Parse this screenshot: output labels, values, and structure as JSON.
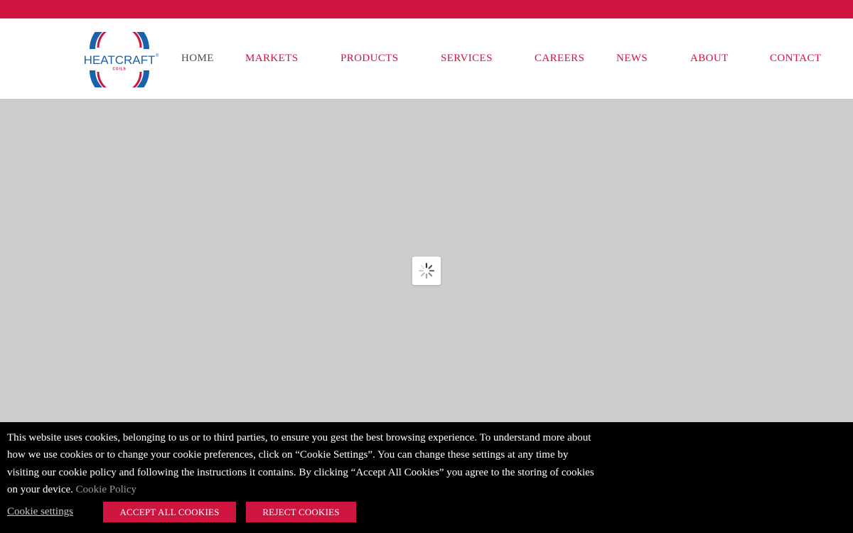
{
  "brand": {
    "name": "HEATCRAFT",
    "sub": "COILS",
    "primary_color": "#cf1440",
    "blue_color": "#1b62ac"
  },
  "nav": {
    "items": [
      {
        "label": "HOME",
        "active": true
      },
      {
        "label": "MARKETS"
      },
      {
        "label": "PRODUCTS"
      },
      {
        "label": "SERVICES"
      },
      {
        "label": "CAREERS"
      },
      {
        "label": "NEWS"
      },
      {
        "label": "ABOUT"
      },
      {
        "label": "CONTACT"
      }
    ]
  },
  "hero": {
    "loading_icon": "spinner-icon"
  },
  "cookie": {
    "text": "This website uses cookies, belonging to us or to third parties, to ensure you gest the best browsing experience. To understand more about how we use cookies or to change your cookie preferences, click on “Cookie Settings”. You can change these settings at any time by visiting our cookie policy and following the instructions it contains. By clicking “Accept All Cookies” you agree to the storing of cookies on your device.",
    "policy_link": "Cookie Policy",
    "settings_label": "Cookie settings",
    "accept_label": "ACCEPT ALL COOKIES",
    "reject_label": "REJECT COOKIES"
  }
}
